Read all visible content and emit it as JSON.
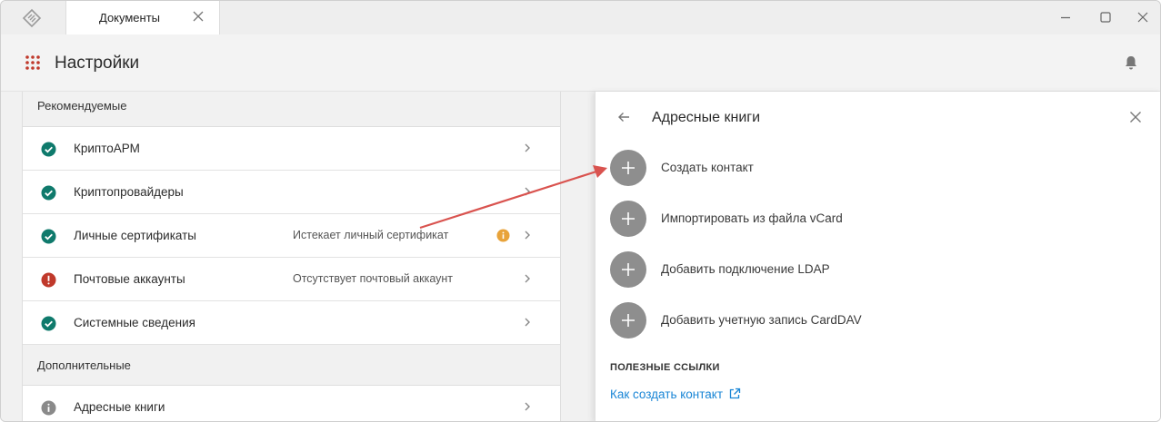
{
  "titlebar": {
    "tab_label": "Документы"
  },
  "header": {
    "title": "Настройки"
  },
  "settings": {
    "recommended_label": "Рекомендуемые",
    "additional_label": "Дополнительные",
    "rows": [
      {
        "label": "КриптоАРМ",
        "status": "",
        "state": "ok"
      },
      {
        "label": "Криптопровайдеры",
        "status": "",
        "state": "ok"
      },
      {
        "label": "Личные сертификаты",
        "status": "Истекает личный сертификат",
        "state": "ok",
        "warning": true
      },
      {
        "label": "Почтовые аккаунты",
        "status": "Отсутствует почтовый аккаунт",
        "state": "error"
      },
      {
        "label": "Системные сведения",
        "status": "",
        "state": "ok"
      }
    ],
    "extra_rows": [
      {
        "label": "Адресные книги",
        "state": "info"
      }
    ]
  },
  "panel": {
    "title": "Адресные книги",
    "actions": [
      {
        "label": "Создать контакт"
      },
      {
        "label": "Импортировать из файла vCard"
      },
      {
        "label": "Добавить подключение LDAP"
      },
      {
        "label": "Добавить учетную запись CardDAV"
      }
    ],
    "links_heading": "ПОЛЕЗНЫЕ ССЫЛКИ",
    "links": [
      {
        "label": "Как создать контакт"
      }
    ]
  },
  "colors": {
    "ok": "#0f7a6c",
    "error": "#c0392b",
    "info": "#8a8a8a",
    "warning": "#e8a33a",
    "link": "#1a86d6",
    "annotation_arrow": "#d9534f"
  },
  "icons": {
    "app": "diamond-logo-icon",
    "menu": "grid-dots-icon",
    "bell": "bell-icon",
    "back": "arrow-left-icon",
    "close": "close-icon",
    "chevron": "chevron-right-icon",
    "plus": "plus-icon",
    "external": "external-link-icon"
  }
}
